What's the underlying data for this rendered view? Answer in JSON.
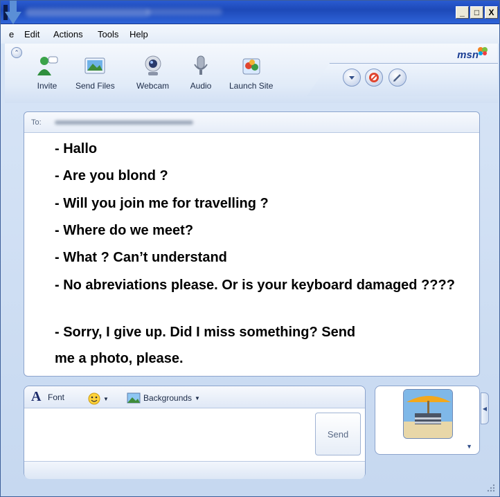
{
  "window": {
    "controls": [
      "_",
      "□",
      "X"
    ]
  },
  "menu": {
    "file_partial": "e",
    "edit": "Edit",
    "actions": "Actions",
    "tools": "Tools",
    "help": "Help"
  },
  "toolbar": {
    "invite": "Invite",
    "send_files": "Send Files",
    "webcam": "Webcam",
    "audio": "Audio",
    "launch_site": "Launch Site",
    "brand": "msn"
  },
  "conversation": {
    "to_label": "To:",
    "messages": [
      "- Hallo",
      "- Are you blond ?",
      "- Will you join me for travelling ?",
      "- Where do we meet?",
      "- What ? Can’t understand",
      "- No abreviations please. Or is your keyboard damaged ????",
      "- Sorry, I give up. Did I miss something? Send",
      "me a photo, please."
    ]
  },
  "compose": {
    "font": "Font",
    "backgrounds": "Backgrounds",
    "send": "Send"
  },
  "colors": {
    "title_bar": "#2a5bd0",
    "brand": "#1c3f94",
    "frame": "#c6d8f0"
  }
}
